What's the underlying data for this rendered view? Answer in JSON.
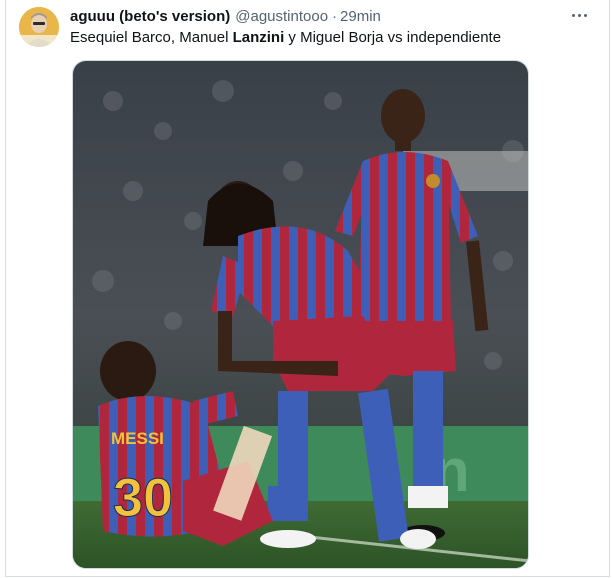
{
  "tweet": {
    "display_name": "aguuu (beto's version)",
    "handle": "@agustintooo",
    "separator": "·",
    "time": "29min",
    "text_before": "Esequiel Barco, Manuel ",
    "text_bold": "Lanzini",
    "text_after": " y Miguel Borja vs independiente"
  },
  "media": {
    "jersey_name": "MESSI",
    "jersey_number": "30"
  },
  "icons": {
    "more": "more-options-icon",
    "avatar": "avatar"
  },
  "colors": {
    "text_primary": "#0f1419",
    "text_secondary": "#536471",
    "border": "#cfd9de"
  }
}
